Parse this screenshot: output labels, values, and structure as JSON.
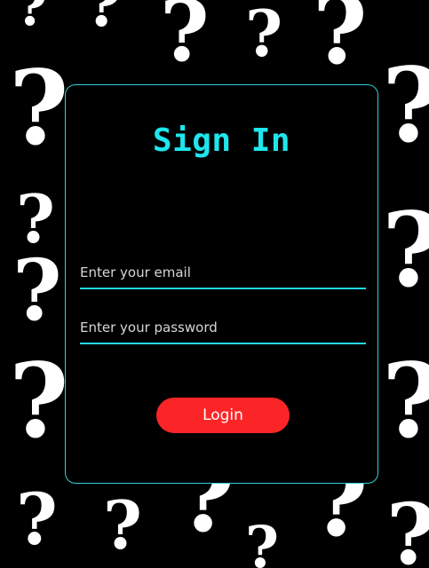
{
  "login_form": {
    "title": "Sign In",
    "email_placeholder": "Enter your email",
    "password_placeholder": "Enter your password",
    "login_label": "Login"
  },
  "background": {
    "pattern_glyph": "?"
  },
  "colors": {
    "accent": "#1ee6ec",
    "button": "#fb2527",
    "background": "#000000",
    "pattern": "#ffffff"
  }
}
